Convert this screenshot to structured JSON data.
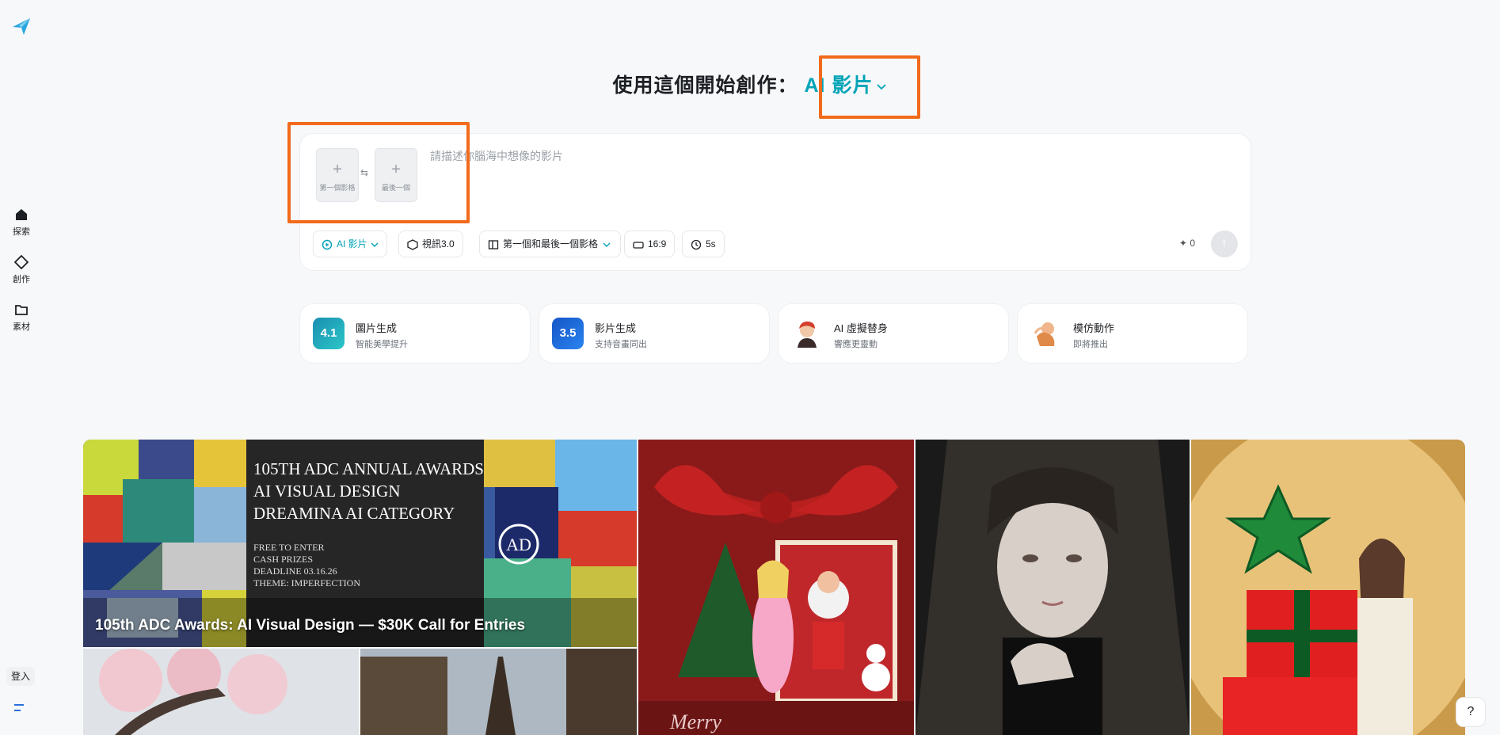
{
  "nav": {
    "items": [
      {
        "label": "探索",
        "icon": "home-icon"
      },
      {
        "label": "創作",
        "icon": "create-icon"
      },
      {
        "label": "素材",
        "icon": "folder-icon"
      }
    ],
    "login_label": "登入"
  },
  "header": {
    "prefix": "使用這個開始創作：",
    "mode_label": "AI 影片"
  },
  "prompt": {
    "first_frame_label": "第一個影格",
    "last_frame_label": "最後一個",
    "swap_icon": "swap-icon",
    "placeholder": "請描述你腦海中想像的影片",
    "chips": {
      "mode": "AI 影片",
      "model": "視訊3.0",
      "frames": "第一個和最後一個影格",
      "ratio": "16:9",
      "duration": "5s"
    },
    "credits": "0"
  },
  "features": [
    {
      "title": "圖片生成",
      "subtitle": "智能美學提升",
      "badge": "4.1",
      "color": "#1a8fb0"
    },
    {
      "title": "影片生成",
      "subtitle": "支持音畫同出",
      "badge": "3.5",
      "color": "#1555c7"
    },
    {
      "title": "AI 虛擬替身",
      "subtitle": "響應更靈動",
      "badge": "",
      "color": "#d4402e"
    },
    {
      "title": "模仿動作",
      "subtitle": "即將推出",
      "badge": "",
      "color": "#e08a4a"
    }
  ],
  "gallery": {
    "banner_caption": "105th ADC Awards: AI Visual Design — $30K Call for Entries",
    "banner_lines": [
      "105TH ADC ANNUAL AWARDS",
      "AI VISUAL DESIGN",
      "DREAMINA AI CATEGORY"
    ],
    "banner_sub": [
      "FREE TO ENTER",
      "CASH PRIZES",
      "DEADLINE 03.16.26",
      "THEME: IMPERFECTION"
    ],
    "xmas_text": "Merry"
  },
  "colors": {
    "accent": "#00a4b7",
    "highlight_box": "#f26a1b"
  }
}
